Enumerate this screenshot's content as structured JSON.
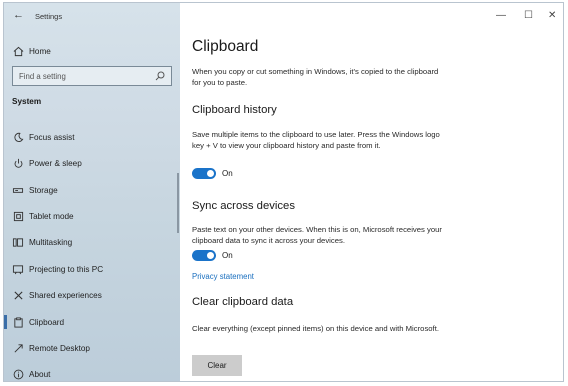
{
  "window": {
    "title": "Settings",
    "minimize": "—",
    "maximize": "☐",
    "close": "✕"
  },
  "sidebar": {
    "home_label": "Home",
    "search_placeholder": "Find a setting",
    "section": "System",
    "selected": "Clipboard",
    "items": [
      {
        "label": "Focus assist",
        "icon": "moon-icon"
      },
      {
        "label": "Power & sleep",
        "icon": "power-icon"
      },
      {
        "label": "Storage",
        "icon": "storage-icon"
      },
      {
        "label": "Tablet mode",
        "icon": "tablet-mode-icon"
      },
      {
        "label": "Multitasking",
        "icon": "multitasking-icon"
      },
      {
        "label": "Projecting to this PC",
        "icon": "projecting-icon"
      },
      {
        "label": "Shared experiences",
        "icon": "shared-experiences-icon"
      },
      {
        "label": "Clipboard",
        "icon": "clipboard-icon"
      },
      {
        "label": "Remote Desktop",
        "icon": "remote-desktop-icon"
      },
      {
        "label": "About",
        "icon": "info-icon"
      }
    ]
  },
  "main": {
    "title": "Clipboard",
    "intro": "When you copy or cut something in Windows, it's copied to the clipboard for you to paste.",
    "history": {
      "heading": "Clipboard history",
      "description": "Save multiple items to the clipboard to use later. Press the Windows logo key + V to view your clipboard history and paste from it.",
      "toggle_state": "On"
    },
    "sync": {
      "heading": "Sync across devices",
      "description": "Paste text on your other devices. When this is on, Microsoft receives your clipboard data to sync it across your devices.",
      "toggle_state": "On",
      "link": "Privacy statement"
    },
    "clear": {
      "heading": "Clear clipboard data",
      "description": "Clear everything (except pinned items) on this device and with Microsoft.",
      "button": "Clear"
    }
  },
  "colors": {
    "accent": "#1a73c9",
    "link": "#1a6fbf",
    "sidebar_bg": "#cfdbe5",
    "button_bg": "#cccccc"
  }
}
